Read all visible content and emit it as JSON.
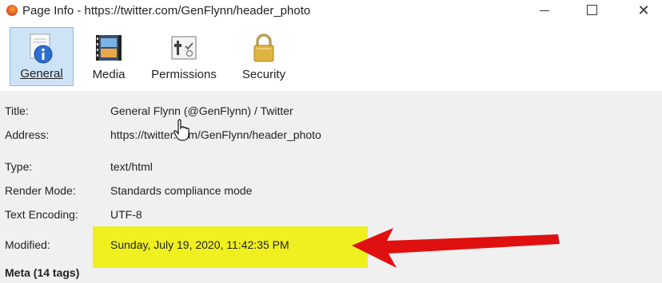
{
  "window": {
    "title": "Page Info - https://twitter.com/GenFlynn/header_photo"
  },
  "toolbar": {
    "tabs": [
      {
        "label": "General",
        "icon": "info-icon"
      },
      {
        "label": "Media",
        "icon": "media-icon"
      },
      {
        "label": "Permissions",
        "icon": "permissions-icon"
      },
      {
        "label": "Security",
        "icon": "lock-icon"
      }
    ],
    "selected": "General"
  },
  "general": {
    "rows": [
      {
        "label": "Title:",
        "value": "General Flynn (@GenFlynn) / Twitter"
      },
      {
        "label": "Address:",
        "value": "https://twitter.com/GenFlynn/header_photo"
      },
      {
        "label": "Type:",
        "value": "text/html"
      },
      {
        "label": "Render Mode:",
        "value": "Standards compliance mode"
      },
      {
        "label": "Text Encoding:",
        "value": "UTF-8"
      },
      {
        "label": "Modified:",
        "value": "Sunday, July 19, 2020, 11:42:35 PM"
      }
    ],
    "meta_label": "Meta (14 tags)"
  },
  "annotation": {
    "highlight_color": "#f0f020",
    "arrow_color": "#e01010"
  }
}
